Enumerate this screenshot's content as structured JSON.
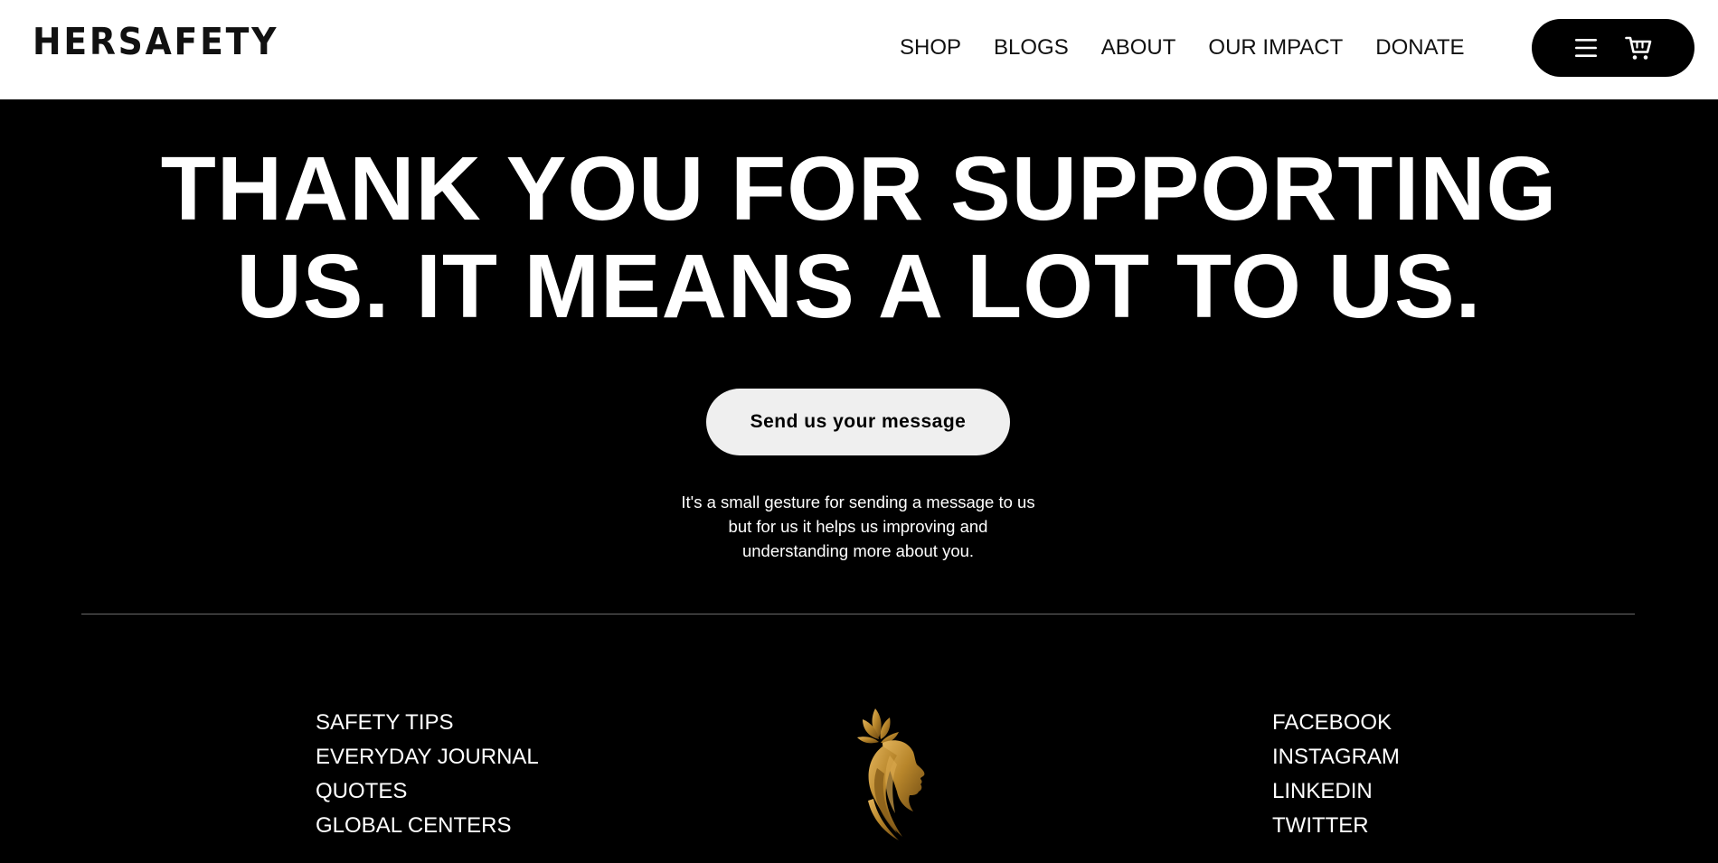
{
  "brand": {
    "logo_text": "HERSAFETY"
  },
  "nav": {
    "items": [
      "SHOP",
      "BLOGS",
      "ABOUT",
      "OUR IMPACT",
      "DONATE"
    ]
  },
  "header_actions": {
    "menu_icon": "hamburger-menu-icon",
    "cart_icon": "shopping-cart-icon",
    "pill_color": "#000000"
  },
  "hero": {
    "title_line1": "THANK YOU FOR SUPPORTING",
    "title_line2": "US. IT MEANS A LOT TO US.",
    "button_label": "Send us your message",
    "note_line1": "It's a small gesture for sending a message to us",
    "note_line2": "but for us it helps us improving and",
    "note_line3": "understanding more about you."
  },
  "footer": {
    "left_links": [
      "SAFETY TIPS",
      "EVERYDAY JOURNAL",
      "QUOTES",
      "GLOBAL CENTERS"
    ],
    "right_links": [
      "FACEBOOK",
      "INSTAGRAM",
      "LINKEDIN",
      "TWITTER"
    ],
    "emblem_icon": "woman-silhouette-lotus-logo",
    "emblem_color": "#b8862b"
  },
  "colors": {
    "header_bg": "#ffffff",
    "page_bg": "#000000",
    "button_bg": "#efefef",
    "divider": "#6b6b6b"
  }
}
